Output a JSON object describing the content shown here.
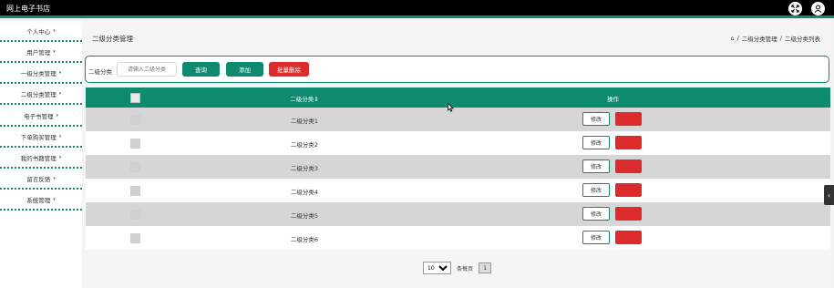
{
  "app": {
    "title": "网上电子书店"
  },
  "sidebar": {
    "items": [
      {
        "label": "个人中心",
        "caret": "▾"
      },
      {
        "label": "用户管理",
        "caret": "▾"
      },
      {
        "label": "一级分类管理",
        "caret": "▾"
      },
      {
        "label": "二级分类管理",
        "caret": "▾"
      },
      {
        "label": "电子书管理",
        "caret": "▾"
      },
      {
        "label": "下单购买管理",
        "caret": "▾"
      },
      {
        "label": "我的书籍管理",
        "caret": "▾"
      },
      {
        "label": "留言反馈",
        "caret": "▾"
      },
      {
        "label": "系统管理",
        "caret": "▾"
      }
    ]
  },
  "header": {
    "page_title": "二级分类管理",
    "breadcrumb": {
      "home_icon": "⌂",
      "sep": "/",
      "level1": "二级分类管理",
      "level2": "二级分类列表"
    }
  },
  "search": {
    "label": "二级分类",
    "placeholder": "请输入二级分类",
    "query_label": "查询",
    "add_label": "添加",
    "batch_delete_label": "批量删除"
  },
  "table": {
    "headers": {
      "name": "二级分类⇕",
      "actions": "操作"
    },
    "edit_label": "修改",
    "rows": [
      {
        "name": "二级分类1"
      },
      {
        "name": "二级分类2"
      },
      {
        "name": "二级分类3"
      },
      {
        "name": "二级分类4"
      },
      {
        "name": "二级分类5"
      },
      {
        "name": "二级分类6"
      }
    ]
  },
  "pagination": {
    "page_size": "10",
    "per_page_label": "条每页",
    "current_page": "1"
  },
  "colors": {
    "primary": "#0e8a6f",
    "danger": "#dc2b2b",
    "topbar": "#000000",
    "row_alt": "#d6d6d6"
  }
}
